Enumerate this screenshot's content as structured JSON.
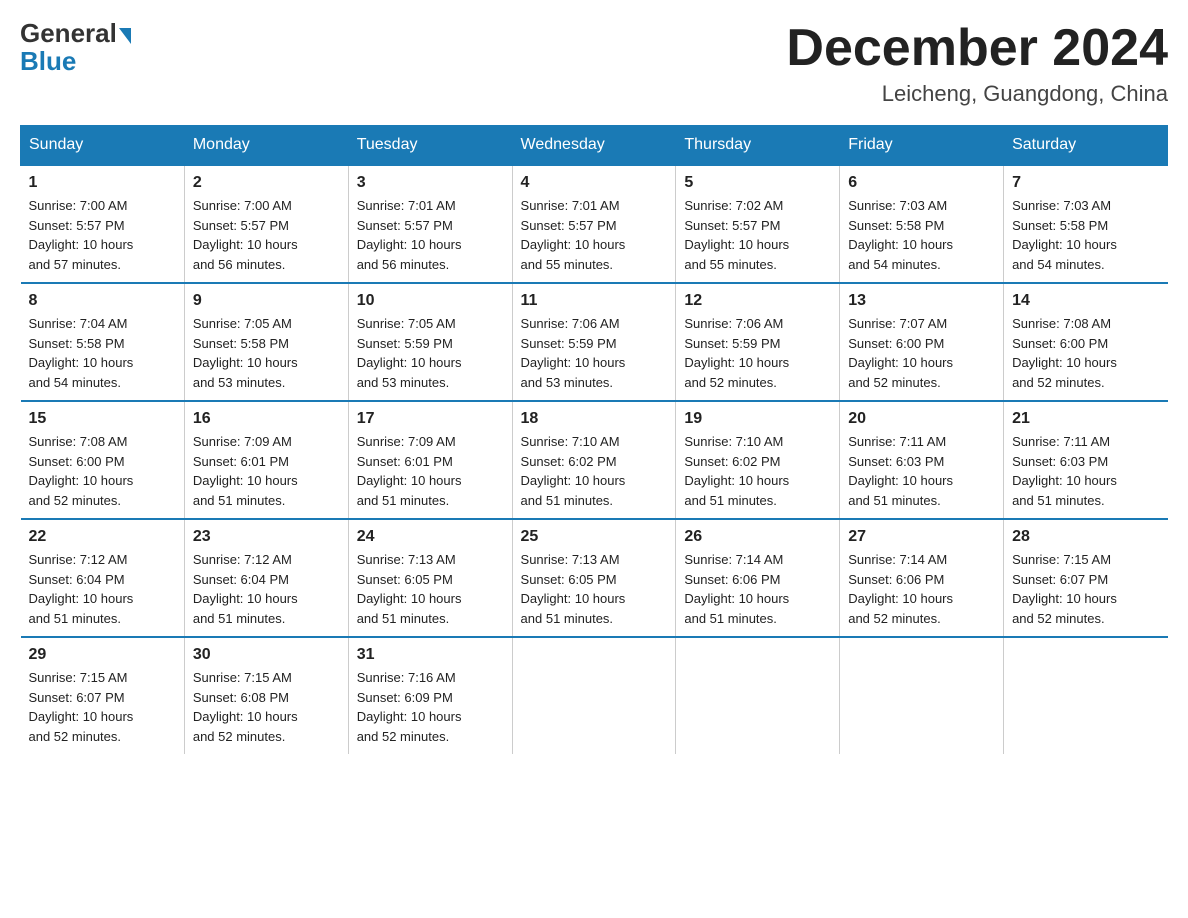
{
  "logo": {
    "general": "General",
    "blue": "Blue"
  },
  "title": "December 2024",
  "location": "Leicheng, Guangdong, China",
  "days_of_week": [
    "Sunday",
    "Monday",
    "Tuesday",
    "Wednesday",
    "Thursday",
    "Friday",
    "Saturday"
  ],
  "weeks": [
    [
      {
        "day": "1",
        "sunrise": "7:00 AM",
        "sunset": "5:57 PM",
        "daylight": "10 hours and 57 minutes."
      },
      {
        "day": "2",
        "sunrise": "7:00 AM",
        "sunset": "5:57 PM",
        "daylight": "10 hours and 56 minutes."
      },
      {
        "day": "3",
        "sunrise": "7:01 AM",
        "sunset": "5:57 PM",
        "daylight": "10 hours and 56 minutes."
      },
      {
        "day": "4",
        "sunrise": "7:01 AM",
        "sunset": "5:57 PM",
        "daylight": "10 hours and 55 minutes."
      },
      {
        "day": "5",
        "sunrise": "7:02 AM",
        "sunset": "5:57 PM",
        "daylight": "10 hours and 55 minutes."
      },
      {
        "day": "6",
        "sunrise": "7:03 AM",
        "sunset": "5:58 PM",
        "daylight": "10 hours and 54 minutes."
      },
      {
        "day": "7",
        "sunrise": "7:03 AM",
        "sunset": "5:58 PM",
        "daylight": "10 hours and 54 minutes."
      }
    ],
    [
      {
        "day": "8",
        "sunrise": "7:04 AM",
        "sunset": "5:58 PM",
        "daylight": "10 hours and 54 minutes."
      },
      {
        "day": "9",
        "sunrise": "7:05 AM",
        "sunset": "5:58 PM",
        "daylight": "10 hours and 53 minutes."
      },
      {
        "day": "10",
        "sunrise": "7:05 AM",
        "sunset": "5:59 PM",
        "daylight": "10 hours and 53 minutes."
      },
      {
        "day": "11",
        "sunrise": "7:06 AM",
        "sunset": "5:59 PM",
        "daylight": "10 hours and 53 minutes."
      },
      {
        "day": "12",
        "sunrise": "7:06 AM",
        "sunset": "5:59 PM",
        "daylight": "10 hours and 52 minutes."
      },
      {
        "day": "13",
        "sunrise": "7:07 AM",
        "sunset": "6:00 PM",
        "daylight": "10 hours and 52 minutes."
      },
      {
        "day": "14",
        "sunrise": "7:08 AM",
        "sunset": "6:00 PM",
        "daylight": "10 hours and 52 minutes."
      }
    ],
    [
      {
        "day": "15",
        "sunrise": "7:08 AM",
        "sunset": "6:00 PM",
        "daylight": "10 hours and 52 minutes."
      },
      {
        "day": "16",
        "sunrise": "7:09 AM",
        "sunset": "6:01 PM",
        "daylight": "10 hours and 51 minutes."
      },
      {
        "day": "17",
        "sunrise": "7:09 AM",
        "sunset": "6:01 PM",
        "daylight": "10 hours and 51 minutes."
      },
      {
        "day": "18",
        "sunrise": "7:10 AM",
        "sunset": "6:02 PM",
        "daylight": "10 hours and 51 minutes."
      },
      {
        "day": "19",
        "sunrise": "7:10 AM",
        "sunset": "6:02 PM",
        "daylight": "10 hours and 51 minutes."
      },
      {
        "day": "20",
        "sunrise": "7:11 AM",
        "sunset": "6:03 PM",
        "daylight": "10 hours and 51 minutes."
      },
      {
        "day": "21",
        "sunrise": "7:11 AM",
        "sunset": "6:03 PM",
        "daylight": "10 hours and 51 minutes."
      }
    ],
    [
      {
        "day": "22",
        "sunrise": "7:12 AM",
        "sunset": "6:04 PM",
        "daylight": "10 hours and 51 minutes."
      },
      {
        "day": "23",
        "sunrise": "7:12 AM",
        "sunset": "6:04 PM",
        "daylight": "10 hours and 51 minutes."
      },
      {
        "day": "24",
        "sunrise": "7:13 AM",
        "sunset": "6:05 PM",
        "daylight": "10 hours and 51 minutes."
      },
      {
        "day": "25",
        "sunrise": "7:13 AM",
        "sunset": "6:05 PM",
        "daylight": "10 hours and 51 minutes."
      },
      {
        "day": "26",
        "sunrise": "7:14 AM",
        "sunset": "6:06 PM",
        "daylight": "10 hours and 51 minutes."
      },
      {
        "day": "27",
        "sunrise": "7:14 AM",
        "sunset": "6:06 PM",
        "daylight": "10 hours and 52 minutes."
      },
      {
        "day": "28",
        "sunrise": "7:15 AM",
        "sunset": "6:07 PM",
        "daylight": "10 hours and 52 minutes."
      }
    ],
    [
      {
        "day": "29",
        "sunrise": "7:15 AM",
        "sunset": "6:07 PM",
        "daylight": "10 hours and 52 minutes."
      },
      {
        "day": "30",
        "sunrise": "7:15 AM",
        "sunset": "6:08 PM",
        "daylight": "10 hours and 52 minutes."
      },
      {
        "day": "31",
        "sunrise": "7:16 AM",
        "sunset": "6:09 PM",
        "daylight": "10 hours and 52 minutes."
      },
      null,
      null,
      null,
      null
    ]
  ]
}
